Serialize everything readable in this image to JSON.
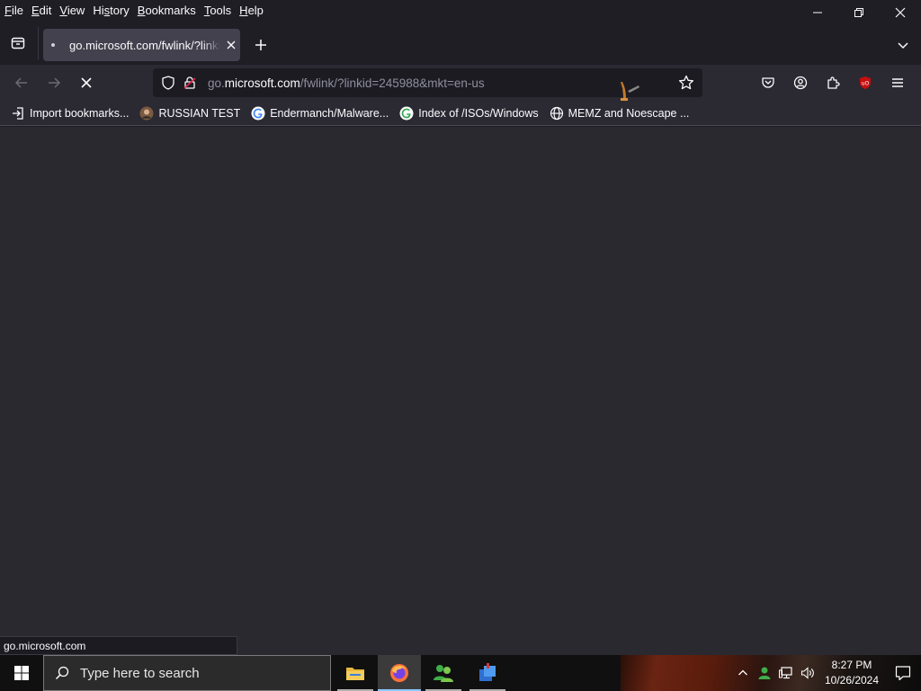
{
  "menubar": {
    "items": [
      {
        "label": "File",
        "mnemonic_index": 0
      },
      {
        "label": "Edit",
        "mnemonic_index": 0
      },
      {
        "label": "View",
        "mnemonic_index": 0
      },
      {
        "label": "History",
        "mnemonic_index": 2
      },
      {
        "label": "Bookmarks",
        "mnemonic_index": 0
      },
      {
        "label": "Tools",
        "mnemonic_index": 0
      },
      {
        "label": "Help",
        "mnemonic_index": 0
      }
    ]
  },
  "tabs": {
    "active_title": "go.microsoft.com/fwlink/?linkid=245988&mkt=en-us"
  },
  "urlbar": {
    "prefix": "go.",
    "host": "microsoft.com",
    "path": "/fwlink/?linkid=245988&mkt=en-us"
  },
  "bookmarks": [
    {
      "label": "Import bookmarks...",
      "icon": "import-icon"
    },
    {
      "label": "RUSSIAN TEST",
      "icon": "avatar-icon"
    },
    {
      "label": "Endermanch/Malware...",
      "icon": "google-icon"
    },
    {
      "label": "Index of /ISOs/Windows",
      "icon": "google-icon"
    },
    {
      "label": "MEMZ and Noescape ...",
      "icon": "globe-icon"
    }
  ],
  "status": {
    "text": "go.microsoft.com"
  },
  "taskbar": {
    "search_placeholder": "Type here to search",
    "time": "8:27 PM",
    "date": "10/26/2024",
    "apps": [
      "file-explorer",
      "firefox",
      "people-app",
      "app-icon"
    ]
  },
  "colors": {
    "toolbar": "#2b2a33",
    "tabstrip": "#1f1e25",
    "content": "#2a2930",
    "accent_blue": "#8ac8ff",
    "ublock_red": "#c50e0e"
  }
}
